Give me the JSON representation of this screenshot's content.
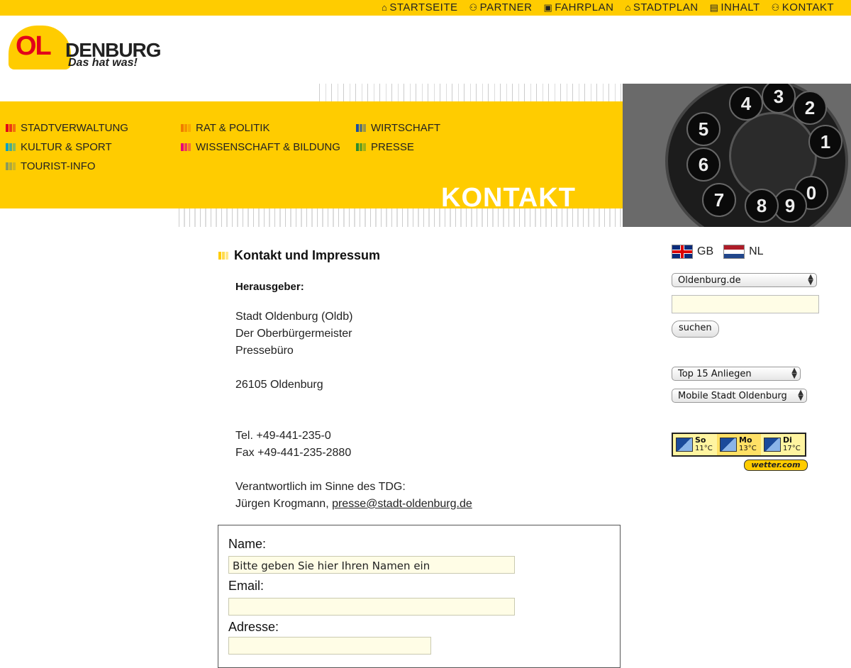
{
  "top_nav": [
    {
      "label": "STARTSEITE",
      "icon": "home-icon"
    },
    {
      "label": "PARTNER",
      "icon": "people-icon"
    },
    {
      "label": "FAHRPLAN",
      "icon": "bus-icon"
    },
    {
      "label": "STADTPLAN",
      "icon": "map-icon"
    },
    {
      "label": "INHALT",
      "icon": "document-icon"
    },
    {
      "label": "KONTAKT",
      "icon": "contact-icon"
    }
  ],
  "logo": {
    "ol": "OL",
    "denburg": "DENBURG",
    "slogan": "Das hat was!"
  },
  "main_nav": [
    {
      "label": "STADTVERWALTUNG",
      "color": "#e2001a"
    },
    {
      "label": "KULTUR & SPORT",
      "color": "#00a0c6"
    },
    {
      "label": "TOURIST-INFO",
      "color": "#8a9a5b"
    },
    {
      "label": "RAT & POLITIK",
      "color": "#f07c00"
    },
    {
      "label": "WISSENSCHAFT & BILDUNG",
      "color": "#e6007e"
    },
    {
      "label": "WIRTSCHAFT",
      "color": "#1d4fa0"
    },
    {
      "label": "PRESSE",
      "color": "#2e8b2e"
    }
  ],
  "banner_title": "KONTAKT",
  "phone_digits": [
    "5",
    "6",
    "7",
    "4",
    "3",
    "2",
    "1",
    "0",
    "9",
    "8"
  ],
  "content": {
    "heading": "Kontakt und Impressum",
    "subheading": "Herausgeber:",
    "address_lines": [
      "Stadt Oldenburg (Oldb)",
      "Der Oberbürgermeister",
      "Pressebüro"
    ],
    "postal": "26105 Oldenburg",
    "tel": "Tel. +49-441-235-0",
    "fax": "Fax +49-441-235-2880",
    "responsible_label": "Verantwortlich im Sinne des TDG:",
    "responsible_name": "Jürgen Krogmann, ",
    "responsible_email": "presse@stadt-oldenburg.de"
  },
  "form": {
    "name_label": "Name:",
    "name_value": "Bitte geben Sie hier Ihren Namen ein",
    "email_label": "Email:",
    "email_value": "",
    "address_label": "Adresse:"
  },
  "sidebar": {
    "lang_gb": "GB",
    "lang_nl": "NL",
    "site_select": "Oldenburg.de",
    "search_value": "",
    "search_button": "suchen",
    "top15_select": "Top 15 Anliegen",
    "mobile_select": "Mobile Stadt Oldenburg"
  },
  "weather": {
    "days": [
      {
        "day": "So",
        "temp": "11°C"
      },
      {
        "day": "Mo",
        "temp": "13°C"
      },
      {
        "day": "Di",
        "temp": "17°C"
      }
    ],
    "provider": "wetter.com"
  }
}
